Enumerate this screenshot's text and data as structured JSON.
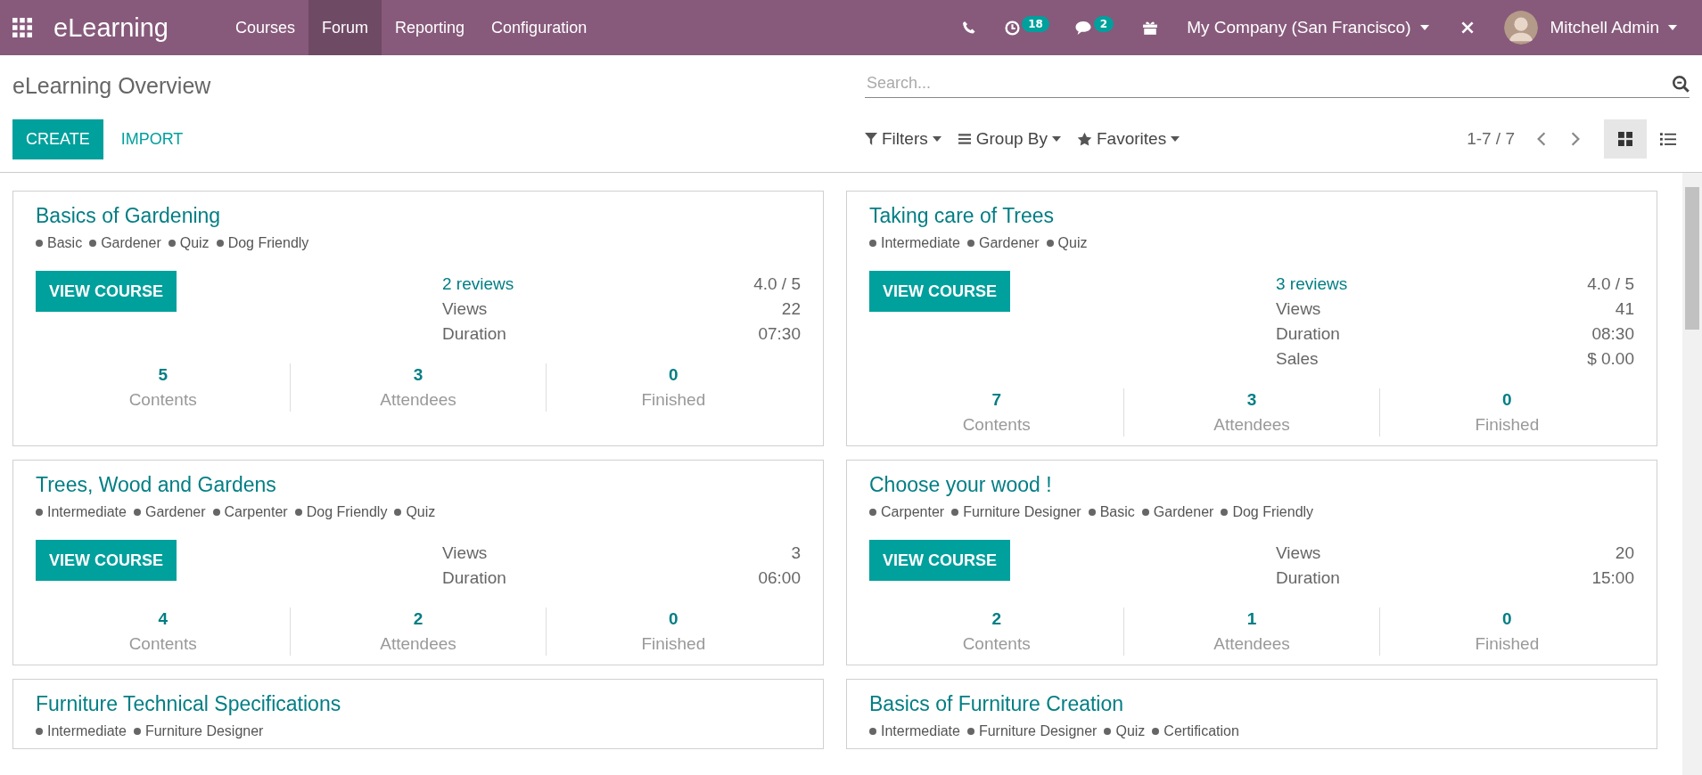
{
  "navbar": {
    "app_name": "eLearning",
    "menu": [
      {
        "label": "Courses",
        "selected": false
      },
      {
        "label": "Forum",
        "selected": true
      },
      {
        "label": "Reporting",
        "selected": false
      },
      {
        "label": "Configuration",
        "selected": false
      }
    ],
    "activity_count": "18",
    "message_count": "2",
    "company": "My Company (San Francisco)",
    "user": "Mitchell Admin"
  },
  "control_panel": {
    "title": "eLearning Overview",
    "create": "CREATE",
    "import": "IMPORT",
    "search": {
      "placeholder": "Search..."
    },
    "filters": "Filters",
    "group_by": "Group By",
    "favorites": "Favorites",
    "pager": "1-7 / 7",
    "views": [
      {
        "kind": "kanban",
        "selected": true
      },
      {
        "kind": "list",
        "selected": false
      }
    ]
  },
  "courses": [
    {
      "title": "Basics of Gardening",
      "tags": [
        "Basic",
        "Gardener",
        "Quiz",
        "Dog Friendly"
      ],
      "button": "VIEW COURSE",
      "stats": [
        {
          "kind": "link",
          "label": "2 reviews",
          "value": "4.0 / 5"
        },
        {
          "kind": "plain",
          "label": "Views",
          "value": "22"
        },
        {
          "kind": "plain",
          "label": "Duration",
          "value": "07:30"
        }
      ],
      "counters": [
        {
          "value": "5",
          "label": "Contents"
        },
        {
          "value": "3",
          "label": "Attendees"
        },
        {
          "value": "0",
          "label": "Finished"
        }
      ]
    },
    {
      "title": "Taking care of Trees",
      "tags": [
        "Intermediate",
        "Gardener",
        "Quiz"
      ],
      "button": "VIEW COURSE",
      "stats": [
        {
          "kind": "link",
          "label": "3 reviews",
          "value": "4.0 / 5"
        },
        {
          "kind": "plain",
          "label": "Views",
          "value": "41"
        },
        {
          "kind": "plain",
          "label": "Duration",
          "value": "08:30"
        },
        {
          "kind": "plain",
          "label": "Sales",
          "value": "$ 0.00"
        }
      ],
      "counters": [
        {
          "value": "7",
          "label": "Contents"
        },
        {
          "value": "3",
          "label": "Attendees"
        },
        {
          "value": "0",
          "label": "Finished"
        }
      ]
    },
    {
      "title": "Trees, Wood and Gardens",
      "tags": [
        "Intermediate",
        "Gardener",
        "Carpenter",
        "Dog Friendly",
        "Quiz"
      ],
      "button": "VIEW COURSE",
      "stats": [
        {
          "kind": "plain",
          "label": "Views",
          "value": "3"
        },
        {
          "kind": "plain",
          "label": "Duration",
          "value": "06:00"
        }
      ],
      "counters": [
        {
          "value": "4",
          "label": "Contents"
        },
        {
          "value": "2",
          "label": "Attendees"
        },
        {
          "value": "0",
          "label": "Finished"
        }
      ]
    },
    {
      "title": "Choose your wood !",
      "tags": [
        "Carpenter",
        "Furniture Designer",
        "Basic",
        "Gardener",
        "Dog Friendly"
      ],
      "button": "VIEW COURSE",
      "stats": [
        {
          "kind": "plain",
          "label": "Views",
          "value": "20"
        },
        {
          "kind": "plain",
          "label": "Duration",
          "value": "15:00"
        }
      ],
      "counters": [
        {
          "value": "2",
          "label": "Contents"
        },
        {
          "value": "1",
          "label": "Attendees"
        },
        {
          "value": "0",
          "label": "Finished"
        }
      ]
    },
    {
      "title": "Furniture Technical Specifications",
      "tags": [
        "Intermediate",
        "Furniture Designer"
      ]
    },
    {
      "title": "Basics of Furniture Creation",
      "tags": [
        "Intermediate",
        "Furniture Designer",
        "Quiz",
        "Certification"
      ]
    }
  ]
}
